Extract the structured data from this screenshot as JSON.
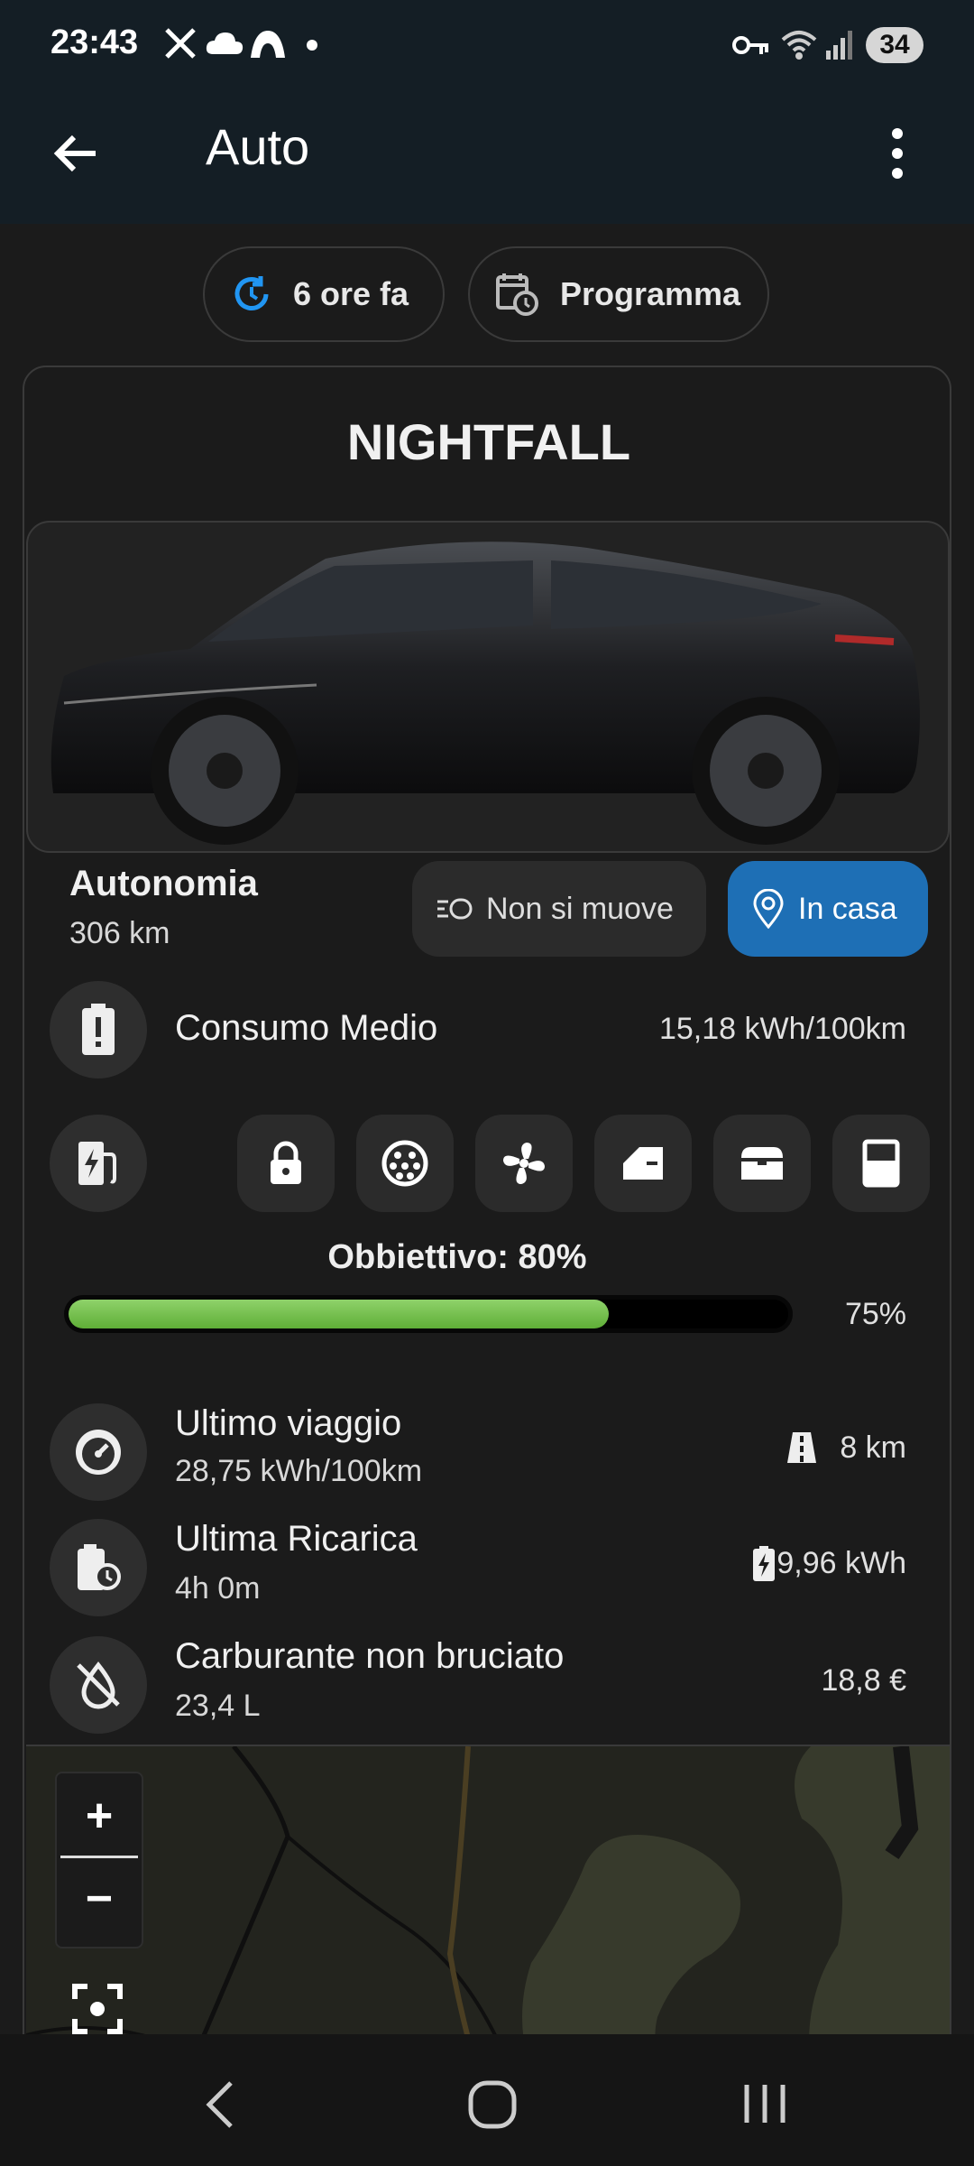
{
  "status_bar": {
    "time": "23:43",
    "battery": "34"
  },
  "app_bar": {
    "title": "Auto"
  },
  "chips": {
    "refresh": "6 ore fa",
    "schedule": "Programma"
  },
  "vehicle": {
    "name": "NIGHTFALL"
  },
  "range": {
    "label": "Autonomia",
    "value": "306 km"
  },
  "motion_chip": "Non si muove",
  "location_chip": "In casa",
  "consumption": {
    "label": "Consumo Medio",
    "value": "15,18 kWh/100km"
  },
  "charge": {
    "target_label": "Obbiettivo: 80%",
    "current_percent": "75%",
    "current_fraction": 0.75,
    "target_fraction": 0.8
  },
  "last_trip": {
    "label": "Ultimo viaggio",
    "sub": "28,75 kWh/100km",
    "distance": "8 km"
  },
  "last_charge": {
    "label": "Ultima Ricarica",
    "sub": "4h 0m",
    "energy": "9,96 kWh"
  },
  "fuel_saved": {
    "label": "Carburante non bruciato",
    "sub": "23,4 L",
    "cost": "18,8 €"
  },
  "map_controls": {
    "zoom_in": "+",
    "zoom_out": "−"
  },
  "colors": {
    "accent_blue": "#1e6fb5",
    "progress_green": "#6fbf45",
    "refresh_icon": "#2196f3"
  }
}
